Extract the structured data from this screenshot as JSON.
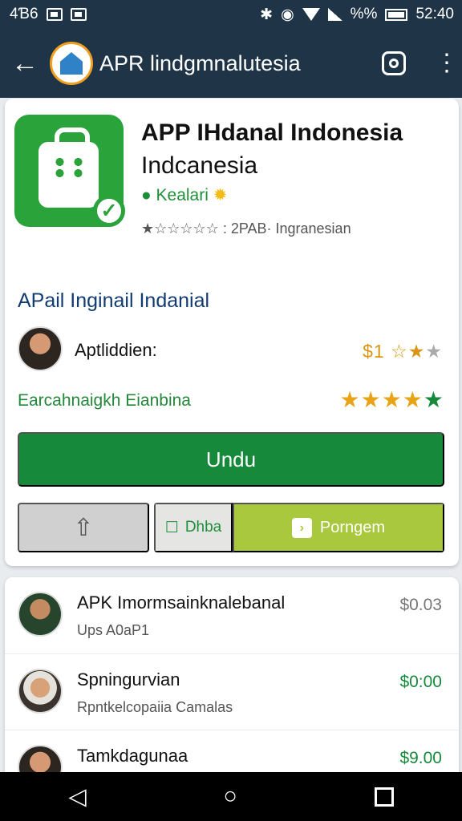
{
  "status": {
    "left": "4Ɓ6",
    "percent": "%%",
    "time": "52:40"
  },
  "app_bar": {
    "title": "APR lindgmnalutesia"
  },
  "app": {
    "name": "APP IHdanal Indonesia",
    "subtitle": "Indcanesia",
    "developer": "Kealari",
    "rating_text": "★☆☆☆☆☆ : 2PAB· Ingranesian"
  },
  "details": {
    "section_title": "APail Inginail Indanial",
    "developer_label": "Aptliddien:",
    "price_rating": "$1",
    "rating_text": "Earcahnaigkh Eianbina",
    "stars": "★★★★"
  },
  "actions": {
    "install": "Undu",
    "share_icon": "share-icon",
    "chat": "Dhba",
    "promo": "Porngem"
  },
  "list": [
    {
      "title": "APK Imormsainknalebanal",
      "subtitle": "Ups A0aP1",
      "price": "$0.03",
      "color": "#777777"
    },
    {
      "title": "Spningurvian",
      "subtitle": "Rpntkelcopaiia Camalas",
      "price": "$0:00",
      "color": "#168a3a"
    },
    {
      "title": "Tamkdagunaa",
      "subtitle": "",
      "price": "$9.00",
      "color": "#168a3a"
    }
  ]
}
